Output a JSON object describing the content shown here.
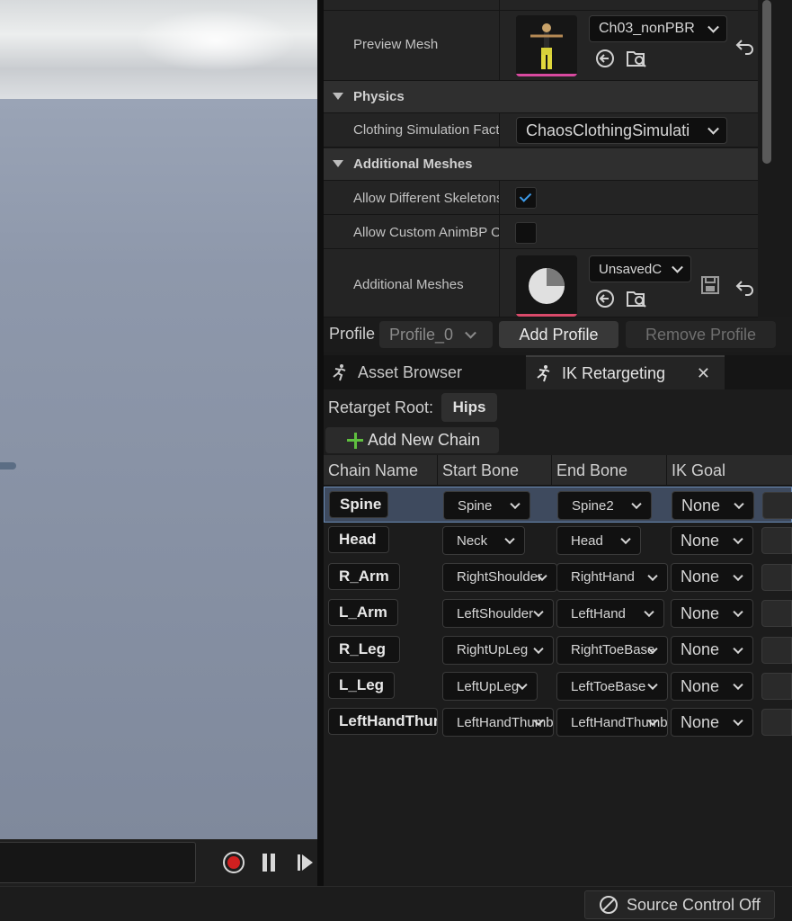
{
  "details": {
    "preview_mesh": {
      "label": "Preview Mesh",
      "value": "Ch03_nonPBR"
    },
    "physics": {
      "category": "Physics",
      "clothing_label": "Clothing Simulation Fact",
      "clothing_value": "ChaosClothingSimulati"
    },
    "additional_meshes": {
      "category": "Additional Meshes",
      "allow_different_skeletons_label": "Allow Different Skeletons",
      "allow_different_skeletons_checked": true,
      "allow_custom_animbp_label": "Allow Custom AnimBP O",
      "allow_custom_animbp_checked": false,
      "meshes_label": "Additional Meshes",
      "meshes_value": "UnsavedC"
    }
  },
  "profile": {
    "label": "Profile",
    "selected": "Profile_0",
    "add_label": "Add Profile",
    "remove_label": "Remove Profile"
  },
  "tabs": [
    {
      "label": "Asset Browser",
      "active": false
    },
    {
      "label": "IK Retargeting",
      "active": true
    }
  ],
  "ik": {
    "retarget_root_label": "Retarget Root:",
    "retarget_root_value": "Hips",
    "add_chain_label": "Add New Chain",
    "columns": [
      "Chain Name",
      "Start Bone",
      "End Bone",
      "IK Goal"
    ],
    "rows": [
      {
        "name": "Spine",
        "start": "Spine",
        "end": "Spine2",
        "goal": "None"
      },
      {
        "name": "Head",
        "start": "Neck",
        "end": "Head",
        "goal": "None"
      },
      {
        "name": "R_Arm",
        "start": "RightShoulder",
        "end": "RightHand",
        "goal": "None"
      },
      {
        "name": "L_Arm",
        "start": "LeftShoulder",
        "end": "LeftHand",
        "goal": "None"
      },
      {
        "name": "R_Leg",
        "start": "RightUpLeg",
        "end": "RightToeBase",
        "goal": "None"
      },
      {
        "name": "L_Leg",
        "start": "LeftUpLeg",
        "end": "LeftToeBase",
        "goal": "None"
      },
      {
        "name": "LeftHandThumb",
        "start": "LeftHandThumb",
        "end": "LeftHandThumb",
        "goal": "None"
      }
    ]
  },
  "status": {
    "source_control": "Source Control Off"
  },
  "colors": {
    "accent_blue": "#3d9be9",
    "record_red": "#d02020",
    "plus_green": "#5fbf3f",
    "thumb_pink": "#d94aa0"
  }
}
